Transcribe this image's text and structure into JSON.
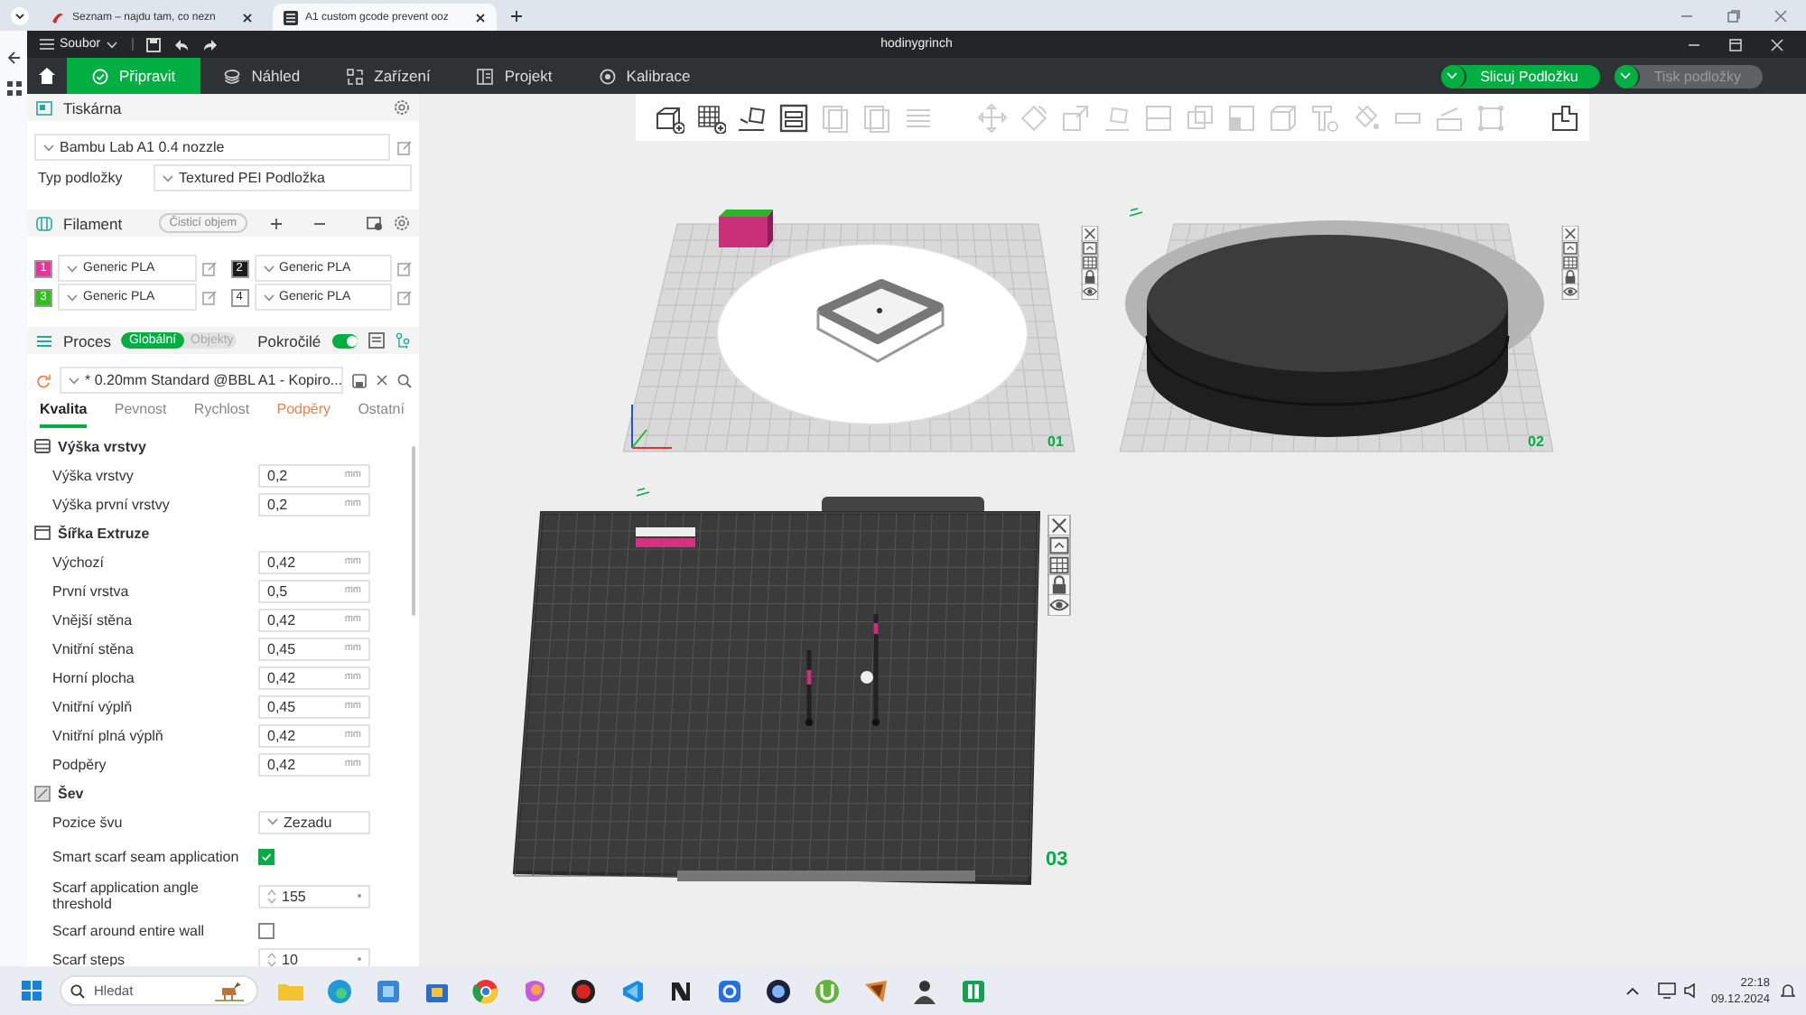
{
  "browser": {
    "tabs": [
      {
        "title": "Seznam – najdu tam, co nezn",
        "selected": false
      },
      {
        "title": "A1 custom gcode prevent ooz",
        "selected": true
      }
    ]
  },
  "app": {
    "menu": "Soubor",
    "title": "hodinygrinch"
  },
  "nav_tabs": [
    {
      "label": "Připravit",
      "selected": true
    },
    {
      "label": "Náhled",
      "selected": false
    },
    {
      "label": "Zařízení",
      "selected": false
    },
    {
      "label": "Projekt",
      "selected": false
    },
    {
      "label": "Kalibrace",
      "selected": false
    }
  ],
  "actions": [
    {
      "label": "Slicuj Podložku",
      "disabled": false
    },
    {
      "label": "Tisk podložky",
      "disabled": true
    }
  ],
  "printer": {
    "title": "Tiskárna",
    "preset": "Bambu Lab A1 0.4 nozzle",
    "plate_type_label": "Typ podložky",
    "plate_type": "Textured PEI Podložka"
  },
  "filament": {
    "title": "Filament",
    "flush_button": "Čisticí objem",
    "slots": [
      {
        "number": "1",
        "color": "#e8359a",
        "name": "Generic PLA"
      },
      {
        "number": "2",
        "color": "#1c1c1c",
        "name": "Generic PLA"
      },
      {
        "number": "3",
        "color": "#2fc01c",
        "name": "Generic PLA"
      },
      {
        "number": "4",
        "color": "#ffffff",
        "name": "Generic PLA"
      }
    ]
  },
  "process": {
    "title": "Proces",
    "scopes": [
      {
        "label": "Globální",
        "selected": true
      },
      {
        "label": "Objekty",
        "selected": false
      }
    ],
    "advanced_label": "Pokročilé",
    "advanced": true,
    "preset": "* 0.20mm Standard @BBL A1 - Kopiro...",
    "tabs": [
      {
        "label": "Kvalita",
        "selected": true,
        "modified": false
      },
      {
        "label": "Pevnost",
        "selected": false,
        "modified": false
      },
      {
        "label": "Rychlost",
        "selected": false,
        "modified": false
      },
      {
        "label": "Podpěry",
        "selected": false,
        "modified": true
      },
      {
        "label": "Ostatní",
        "selected": false,
        "modified": false
      }
    ]
  },
  "settings_groups": [
    {
      "title": "Výška vrstvy",
      "rows": [
        {
          "kind": "number",
          "label": "Výška vrstvy",
          "value": "0,2",
          "unit": "mm"
        },
        {
          "kind": "number",
          "label": "Výška první vrstvy",
          "value": "0,2",
          "unit": "mm"
        }
      ]
    },
    {
      "title": "Šířka Extruze",
      "rows": [
        {
          "kind": "number",
          "label": "Výchozí",
          "value": "0,42",
          "unit": "mm"
        },
        {
          "kind": "number",
          "label": "První vrstva",
          "value": "0,5",
          "unit": "mm"
        },
        {
          "kind": "number",
          "label": "Vnější stěna",
          "value": "0,42",
          "unit": "mm"
        },
        {
          "kind": "number",
          "label": "Vnitřní stěna",
          "value": "0,45",
          "unit": "mm"
        },
        {
          "kind": "number",
          "label": "Horní plocha",
          "value": "0,42",
          "unit": "mm"
        },
        {
          "kind": "number",
          "label": "Vnitřní výplň",
          "value": "0,45",
          "unit": "mm"
        },
        {
          "kind": "number",
          "label": "Vnitřní plná výplň",
          "value": "0,42",
          "unit": "mm"
        },
        {
          "kind": "number",
          "label": "Podpěry",
          "value": "0,42",
          "unit": "mm"
        }
      ]
    },
    {
      "title": "Šev",
      "rows": [
        {
          "kind": "select",
          "label": "Pozice švu",
          "value": "Zezadu"
        },
        {
          "kind": "checkbox",
          "label": "Smart scarf seam application",
          "checked": true
        },
        {
          "kind": "spin",
          "label": "Scarf application angle threshold",
          "value": "155"
        },
        {
          "kind": "checkbox",
          "label": "Scarf around entire wall",
          "checked": false
        },
        {
          "kind": "spin",
          "label": "Scarf steps",
          "value": "10"
        }
      ]
    }
  ],
  "plates": [
    {
      "label": "01"
    },
    {
      "label": "02"
    },
    {
      "label": "03"
    }
  ],
  "taskbar": {
    "search_placeholder": "Hledat",
    "time": "22:18",
    "date": "09.12.2024"
  }
}
